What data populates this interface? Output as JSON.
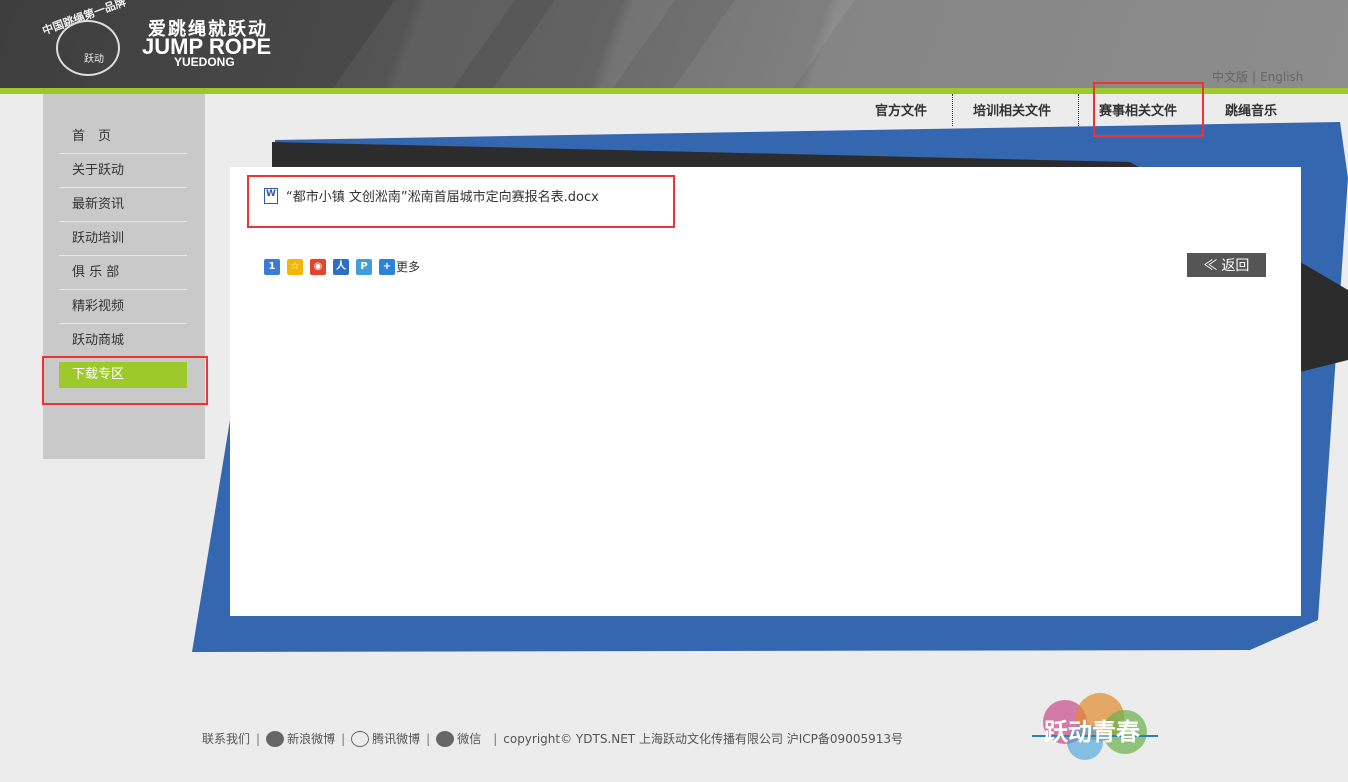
{
  "header": {
    "logo_ring_text": "中国跳绳第一品牌",
    "logo_inner_text": "跃动",
    "slogan_cn": "爱跳绳就跃动",
    "slogan_en": "JUMP ROPE",
    "slogan_sub": "YUEDONG",
    "lang_cn": "中文版",
    "lang_sep": "|",
    "lang_en": "English"
  },
  "topnav": {
    "items": [
      {
        "label": "官方文件"
      },
      {
        "label": "培训相关文件"
      },
      {
        "label": "赛事相关文件"
      },
      {
        "label": "跳绳音乐"
      }
    ],
    "active": "赛事相关文件"
  },
  "sidebar": {
    "items": [
      {
        "label": "首　页"
      },
      {
        "label": "关于跃动"
      },
      {
        "label": "最新资讯"
      },
      {
        "label": "跃动培训"
      },
      {
        "label": "俱 乐 部"
      },
      {
        "label": "精彩视频"
      },
      {
        "label": "跃动商城"
      },
      {
        "label": "下载专区"
      }
    ],
    "active": "下载专区"
  },
  "content": {
    "file_name": "“都市小镇 文创淞南”淞南首届城市定向赛报名表.docx",
    "share_more": "更多",
    "back_label": "≪  返回"
  },
  "footer": {
    "contact": "联系我们",
    "sina": "新浪微博",
    "tencent": "腾讯微博",
    "wechat": "微信",
    "copyright": "copyright© YDTS.NET 上海跃动文化传播有限公司 沪ICP备09005913号",
    "youth_logo": "跃动青春"
  },
  "colors": {
    "accent_green": "#9dc92a",
    "deco_blue": "#3566b0",
    "deco_dark": "#2c2c2c",
    "highlight_red": "#ee3333"
  }
}
